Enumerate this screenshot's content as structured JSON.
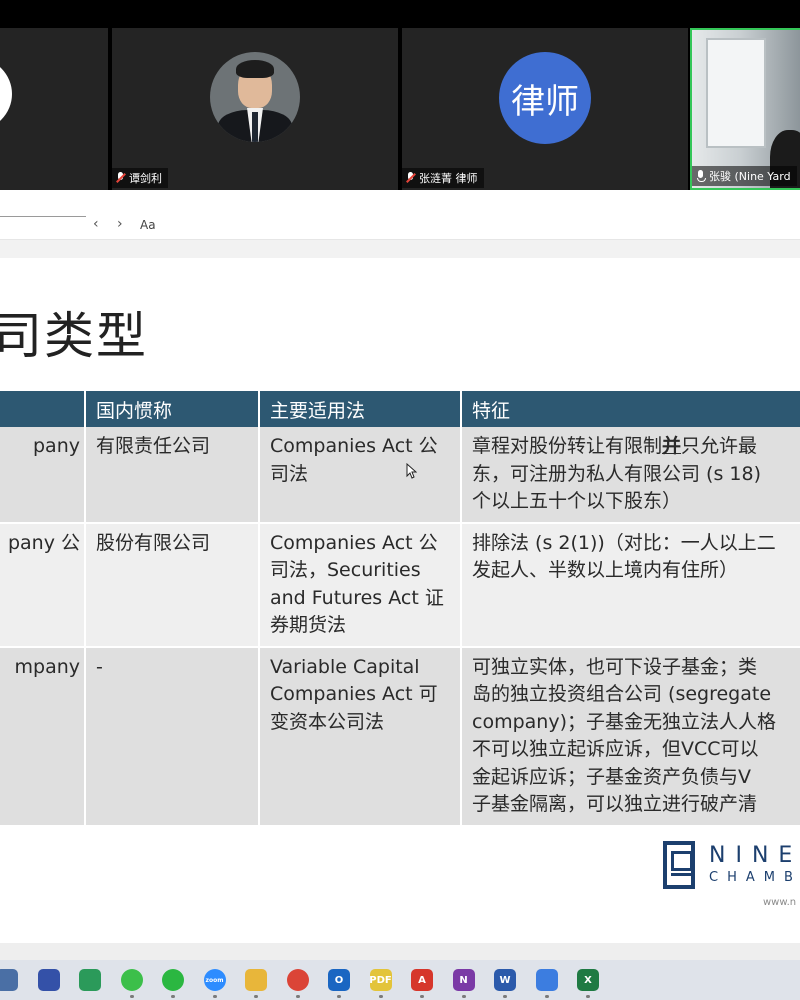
{
  "meeting": {
    "participants": [
      {
        "name": "",
        "mic": "unknown"
      },
      {
        "name": "谭剑利",
        "mic": "muted"
      },
      {
        "name": "张涟菁 律师",
        "mic": "muted",
        "avatar_text": "律师"
      },
      {
        "name": "张骏 (Nine Yard",
        "mic": "on"
      }
    ],
    "active_speaker_color": "#35c759"
  },
  "viewer": {
    "prev_icon": "‹",
    "next_icon": "›",
    "font_size_label": "Aa"
  },
  "slide": {
    "title": "司类型",
    "table": {
      "header_color": "#2d5872",
      "headers": [
        "",
        "国内惯称",
        "主要适用法",
        "特征"
      ],
      "rows": [
        {
          "c0": [
            "pany"
          ],
          "c1": [
            "有限责任公司"
          ],
          "c2": [
            "Companies Act 公",
            "司法"
          ],
          "c3_line1_a": "章程对股份转让有限制",
          "c3_line1_emph": "并",
          "c3_line1_b": "只允许最",
          "c3_rest": [
            "东，可注册为私人有限公司 (s 18)",
            "个以上五十个以下股东）"
          ]
        },
        {
          "c0": [
            "pany 公"
          ],
          "c1": [
            "股份有限公司"
          ],
          "c2": [
            "Companies Act 公",
            "司法，Securities",
            "and Futures Act 证",
            "券期货法"
          ],
          "c3": [
            "排除法 (s 2(1))（对比：一人以上二",
            "发起人、半数以上境内有住所）"
          ]
        },
        {
          "c0": [
            "mpany"
          ],
          "c1": [
            "-"
          ],
          "c2": [
            "Variable Capital",
            "Companies Act 可",
            "变资本公司法"
          ],
          "c3": [
            "可独立实体，也可下设子基金；类",
            "岛的独立投资组合公司 (segregate",
            "company)；子基金无独立法人人格",
            "不可以独立起诉应诉，但VCC可以",
            "金起诉应诉；子基金资产负债与V",
            "子基金隔离，可以独立进行破产清"
          ]
        }
      ]
    },
    "logo": {
      "line1": "NINE",
      "line2": "CHAMBE",
      "url": "www.n"
    }
  },
  "taskbar": {
    "apps": [
      {
        "name": "calculator",
        "label": "",
        "color": "#4a6fa5"
      },
      {
        "name": "grid-app",
        "label": "",
        "color": "#3451a8"
      },
      {
        "name": "image-app",
        "label": "",
        "color": "#2b9a5a"
      },
      {
        "name": "wechat",
        "label": "",
        "color": "#3cbf4a"
      },
      {
        "name": "whatsapp",
        "label": "",
        "color": "#2bb741"
      },
      {
        "name": "zoom",
        "label": "zoom",
        "color": "#2d8cff"
      },
      {
        "name": "file-explorer",
        "label": "",
        "color": "#e8b63a"
      },
      {
        "name": "chrome",
        "label": "",
        "color": "#db4437"
      },
      {
        "name": "outlook",
        "label": "O",
        "color": "#1a66c2"
      },
      {
        "name": "pdf-app",
        "label": "PDF",
        "color": "#e3c43a"
      },
      {
        "name": "acrobat",
        "label": "A",
        "color": "#d6362b"
      },
      {
        "name": "onenote",
        "label": "N",
        "color": "#7b3aa6"
      },
      {
        "name": "word",
        "label": "W",
        "color": "#2b5aab"
      },
      {
        "name": "meeting-app",
        "label": "",
        "color": "#3c7de0"
      },
      {
        "name": "excel",
        "label": "X",
        "color": "#1f7a43"
      }
    ]
  }
}
